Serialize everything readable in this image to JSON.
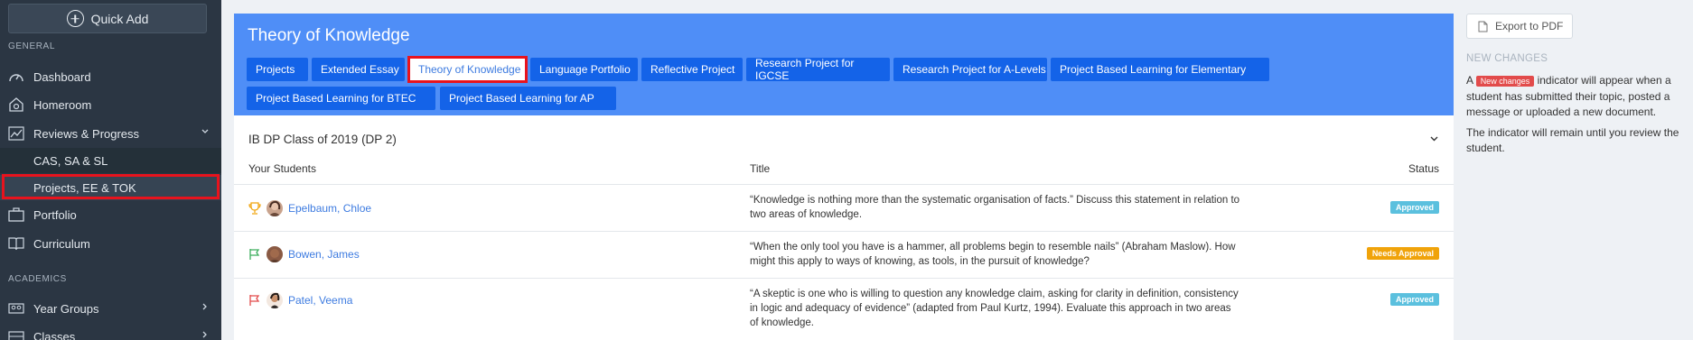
{
  "sidebar": {
    "quick_add": "Quick Add",
    "general_label": "GENERAL",
    "academics_label": "ACADEMICS",
    "items": [
      {
        "label": "Dashboard",
        "icon": "dashboard-icon"
      },
      {
        "label": "Homeroom",
        "icon": "homeroom-icon"
      },
      {
        "label": "Reviews & Progress",
        "icon": "chart-icon"
      },
      {
        "label": "Portfolio",
        "icon": "briefcase-icon"
      },
      {
        "label": "Curriculum",
        "icon": "book-icon"
      },
      {
        "label": "Year Groups",
        "icon": "groups-icon"
      },
      {
        "label": "Classes",
        "icon": "classes-icon"
      }
    ],
    "sub_items": [
      {
        "label": "CAS, SA & SL"
      },
      {
        "label": "Projects, EE & TOK"
      }
    ]
  },
  "main": {
    "title": "Theory of Knowledge",
    "tabs": [
      "Projects",
      "Extended Essay",
      "Theory of Knowledge",
      "Language Portfolio",
      "Reflective Project",
      "Research Project for IGCSE",
      "Research Project for A-Levels",
      "Project Based Learning for Elementary",
      "Project Based Learning for BTEC",
      "Project Based Learning for AP"
    ],
    "active_tab": "Theory of Knowledge",
    "class_name": "IB DP Class of 2019 (DP 2)",
    "columns": {
      "students": "Your Students",
      "title": "Title",
      "status": "Status"
    },
    "rows": [
      {
        "name": "Epelbaum, Chloe",
        "flag": "trophy-icon",
        "title": "“Knowledge is nothing more than the systematic organisation of facts.” Discuss this statement in relation to two areas of knowledge.",
        "status": "Approved"
      },
      {
        "name": "Bowen, James",
        "flag": "green-flag-icon",
        "title": "“When the only tool you have is a hammer, all problems begin to resemble nails” (Abraham Maslow). How might this apply to ways of knowing, as tools, in the pursuit of knowledge?",
        "status": "Needs Approval"
      },
      {
        "name": "Patel, Veema",
        "flag": "red-flag-icon",
        "title": "“A skeptic is one who is willing to question any knowledge claim, asking for clarity in definition, consistency in logic and adequacy of evidence” (adapted from Paul Kurtz, 1994). Evaluate this approach in two areas of knowledge.",
        "status": "Approved"
      }
    ]
  },
  "right_panel": {
    "export_label": "Export to PDF",
    "new_changes_title": "NEW CHANGES",
    "text_before_badge": "A",
    "badge_label": "New changes",
    "text_after_badge": "indicator will appear when a student has submitted their topic, posted a message or uploaded a new document.",
    "paragraph2": "The indicator will remain until you review the student."
  },
  "colors": {
    "header_blue": "#4f8ef7",
    "tab_blue": "#1463e8",
    "approved": "#5bc0de",
    "needs_approval": "#f0a30a",
    "highlight": "#e8131d"
  }
}
